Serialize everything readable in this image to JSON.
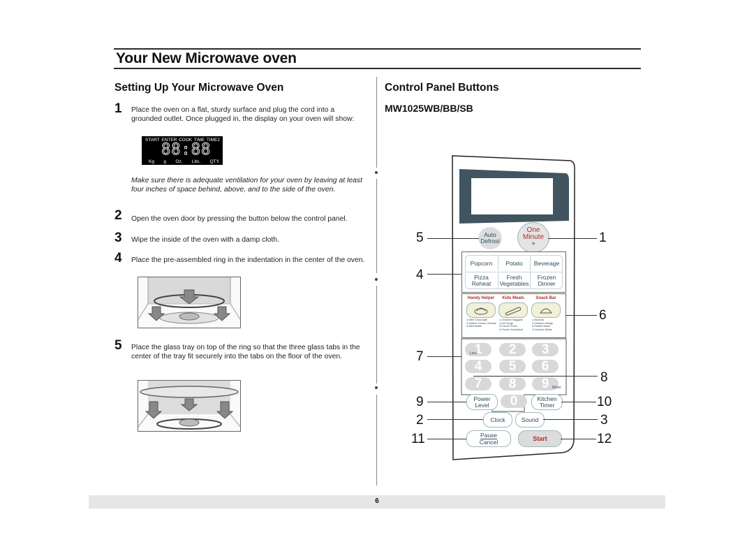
{
  "header": {
    "title": "Your New Microwave oven"
  },
  "left": {
    "heading": "Setting Up Your Microwave Oven",
    "steps": [
      {
        "num": "1",
        "text": "Place the oven on a flat, sturdy surface and plug the cord into a grounded outlet. Once plugged in, the display on your oven will show:"
      },
      {
        "num": "2",
        "text": "Open the oven door by pressing the button below the control panel."
      },
      {
        "num": "3",
        "text": "Wipe the inside of the oven with a damp cloth."
      },
      {
        "num": "4",
        "text": "Place the pre-assembled ring in the indentation in the center of the oven."
      },
      {
        "num": "5",
        "text": "Place the glass tray on top of the ring so that the three glass tabs in the center of the tray fit securely into the tabs on the floor of the oven."
      }
    ],
    "note": "Make sure there is adequate ventilation for your oven by leaving at least four inches of space behind, above, and to the side of the oven.",
    "display": {
      "top_labels": [
        "START",
        "ENTER",
        "COOK",
        "TIME",
        "TIME2"
      ],
      "digits": "88:88",
      "bottom_labels": [
        "Kg",
        "g",
        "Oz.",
        "Lbs.",
        "QTY."
      ]
    }
  },
  "right": {
    "heading": "Control Panel Buttons",
    "model": "MW1025WB/BB/SB",
    "buttons": {
      "auto_defrost": [
        "Auto",
        "Defrost"
      ],
      "one_minute": [
        "One",
        "Minute",
        "+"
      ],
      "popcorn": "Popcorn",
      "potato": "Potato",
      "beverage": "Beverage",
      "pizza": [
        "Pizza",
        "Reheat"
      ],
      "fresh": [
        "Fresh",
        "Vegetables"
      ],
      "frozen": [
        "Frozen",
        "Dinner"
      ],
      "handy_helper": "Handy Helper",
      "kids_meals": "Kids Meals",
      "snack_bar": "Snack Bar",
      "handy_list": [
        "1.Melt Chocolate",
        "2.Soften Cream Cheese",
        "3.Melt Butter"
      ],
      "kids_list": [
        "1.Chicken Nuggets",
        "2.Hot Dogs",
        "3.French Fries",
        "4.Frozen Sandwich"
      ],
      "snack_list": [
        "1.Nachos",
        "2.Chicken Wings",
        "3.Potato Skins",
        "4.Cheese Sticks"
      ],
      "digits": [
        "1",
        "2",
        "3",
        "4",
        "5",
        "6",
        "7",
        "8",
        "9",
        "0"
      ],
      "less": "Less",
      "more": "More",
      "power_level": [
        "Power",
        "Level"
      ],
      "kitchen_timer": [
        "Kitchen",
        "Timer"
      ],
      "clock": "Clock",
      "sound": "Sound",
      "pause_cancel": [
        "Pause",
        "Cancel"
      ],
      "start": "Start"
    },
    "callouts": [
      "5",
      "1",
      "4",
      "6",
      "7",
      "8",
      "9",
      "10",
      "2",
      "3",
      "11",
      "12"
    ]
  },
  "footer": {
    "page": "6"
  },
  "colors": {
    "accent_red": "#b0302a",
    "panel_display": "#415560",
    "button_text": "#2d4a5a"
  }
}
